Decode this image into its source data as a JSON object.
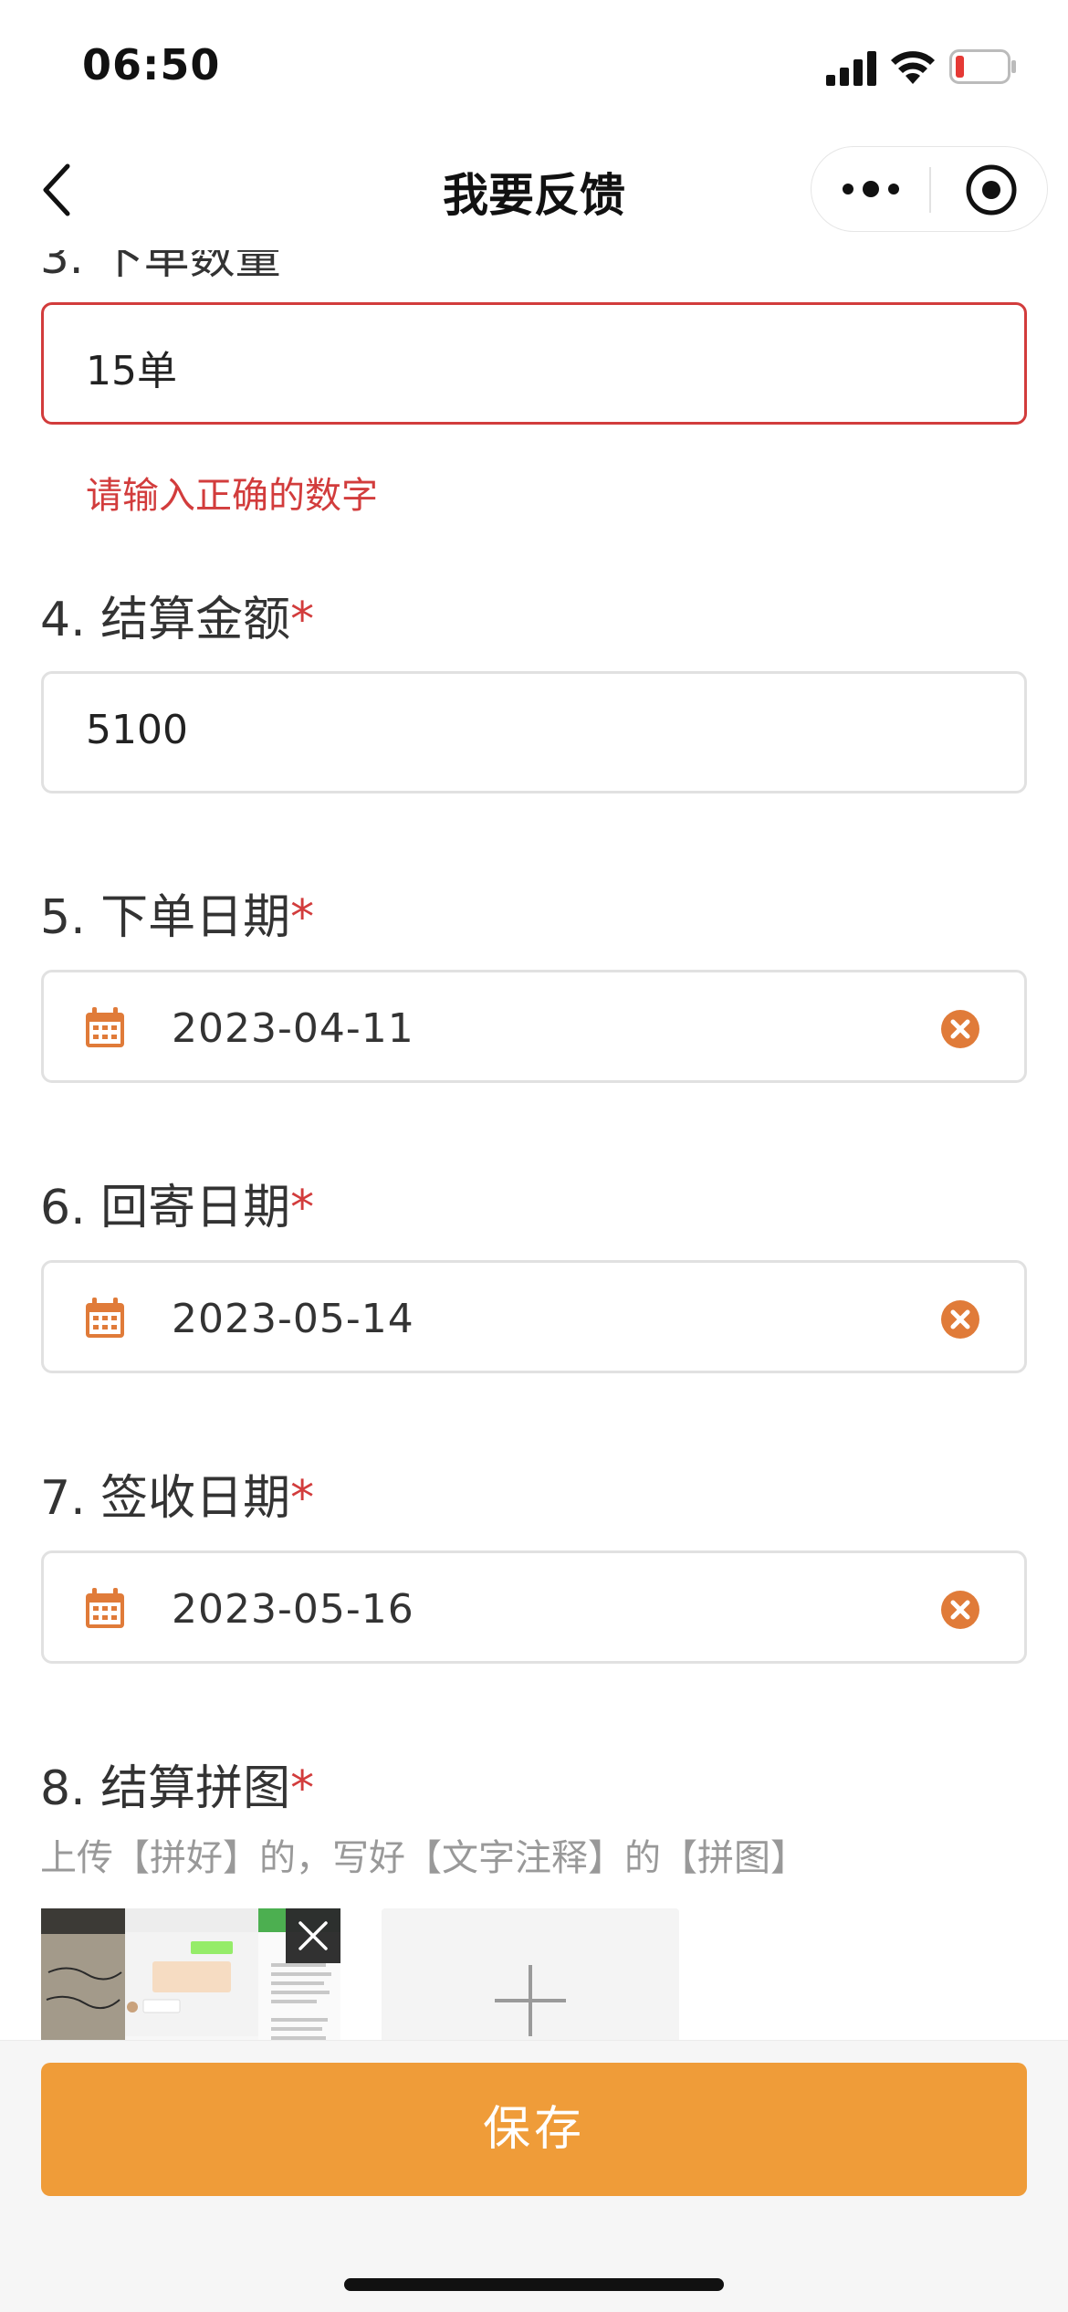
{
  "status_bar": {
    "time": "06:50"
  },
  "nav": {
    "title": "我要反馈"
  },
  "form": {
    "q3": {
      "label_partial": "3. 下单数量",
      "value": "15单",
      "error": "请输入正确的数字"
    },
    "q4": {
      "label": "4. 结算金额",
      "required": "*",
      "value": "5100"
    },
    "q5": {
      "label": "5. 下单日期",
      "required": "*",
      "value": "2023-04-11"
    },
    "q6": {
      "label": "6. 回寄日期",
      "required": "*",
      "value": "2023-05-14"
    },
    "q7": {
      "label": "7. 签收日期",
      "required": "*",
      "value": "2023-05-16"
    },
    "q8": {
      "label": "8. 结算拼图",
      "required": "*",
      "hint": "上传【拼好】的，写好【文字注释】的【拼图】"
    }
  },
  "footer": {
    "save_label": "保存"
  },
  "colors": {
    "accent": "#ef9c39",
    "error": "#d23c3c",
    "icon": "#e07b39"
  },
  "icons": [
    "signal-icon",
    "wifi-icon",
    "battery-icon",
    "back-icon",
    "more-icon",
    "close-miniprogram-icon",
    "calendar-icon",
    "clear-icon",
    "plus-icon",
    "remove-image-icon"
  ]
}
